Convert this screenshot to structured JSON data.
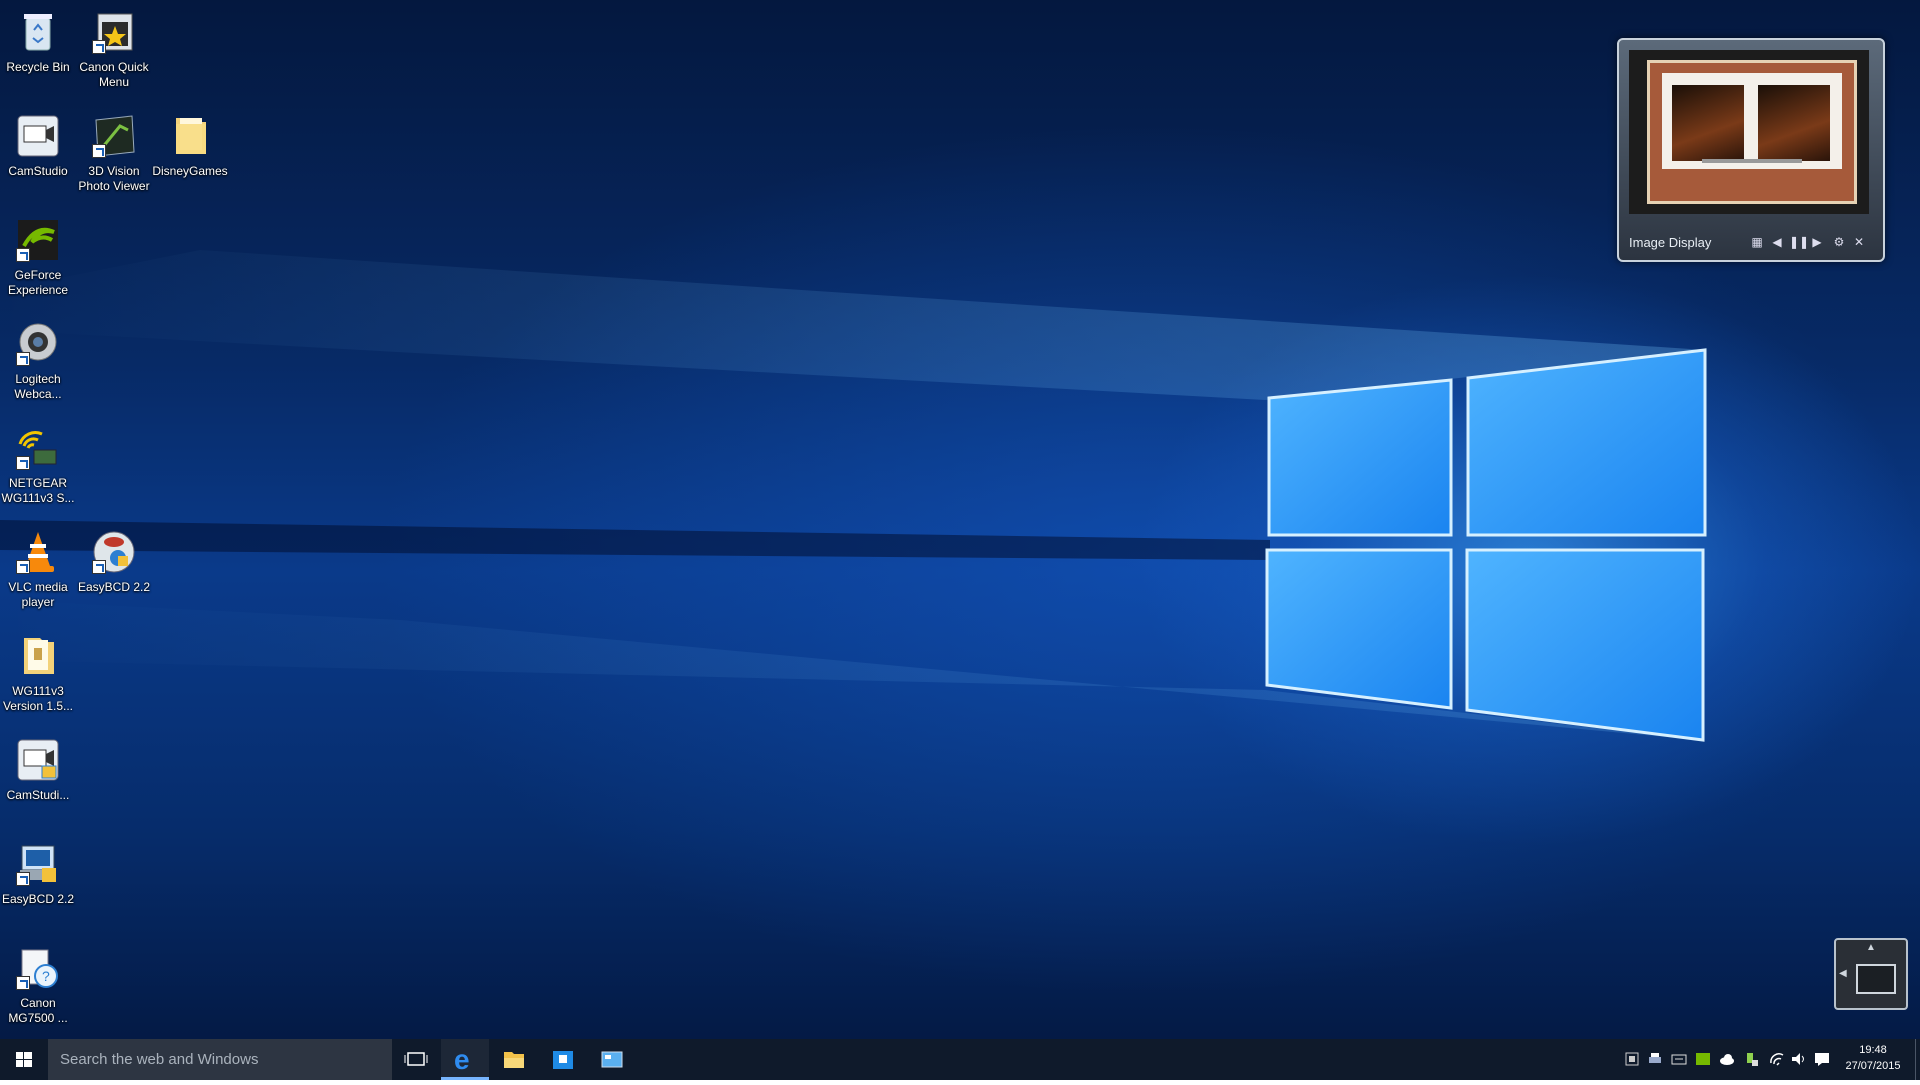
{
  "desktop_icons": [
    {
      "label": "Recycle Bin",
      "icon": "recycle-bin-icon"
    },
    {
      "label": "Canon Quick Menu",
      "icon": "canon-quick-menu-icon"
    },
    {
      "label": "CamStudio",
      "icon": "camstudio-icon"
    },
    {
      "label": "3D Vision Photo Viewer",
      "icon": "3d-vision-icon"
    },
    {
      "label": "DisneyGames",
      "icon": "folder-icon"
    },
    {
      "label": "GeForce Experience",
      "icon": "geforce-icon"
    },
    {
      "label": "Logitech Webca...",
      "icon": "webcam-icon"
    },
    {
      "label": "NETGEAR WG111v3 S...",
      "icon": "netgear-icon"
    },
    {
      "label": "VLC media player",
      "icon": "vlc-icon"
    },
    {
      "label": "EasyBCD 2.2",
      "icon": "easybcd-icon"
    },
    {
      "label": "WG111v3 Version 1.5...",
      "icon": "folder-icon"
    },
    {
      "label": "CamStudi...",
      "icon": "camstudio-icon"
    },
    {
      "label": "EasyBCD 2.2",
      "icon": "easybcd-setup-icon"
    },
    {
      "label": "Canon MG7500 ...",
      "icon": "canon-help-icon"
    }
  ],
  "gadget": {
    "title": "Image Display",
    "controls": [
      "grid-icon",
      "previous-icon",
      "pause-icon",
      "next-icon",
      "settings-icon",
      "close-icon"
    ]
  },
  "taskbar": {
    "search_placeholder": "Search the web and Windows",
    "apps": [
      "task-view-icon",
      "edge-icon",
      "file-explorer-icon",
      "store-icon",
      "desktop-app-icon"
    ],
    "tray": [
      "tray-app-icon",
      "tray-printer-icon",
      "tray-keyboard-icon",
      "tray-nvidia-icon",
      "tray-onedrive-icon",
      "tray-usb-icon",
      "wifi-icon",
      "volume-icon",
      "action-center-icon"
    ],
    "time": "19:48",
    "date": "27/07/2015"
  },
  "colors": {
    "accent": "#77b5ff",
    "taskbar": "#0f1a2b",
    "search_box": "#2d3542"
  }
}
